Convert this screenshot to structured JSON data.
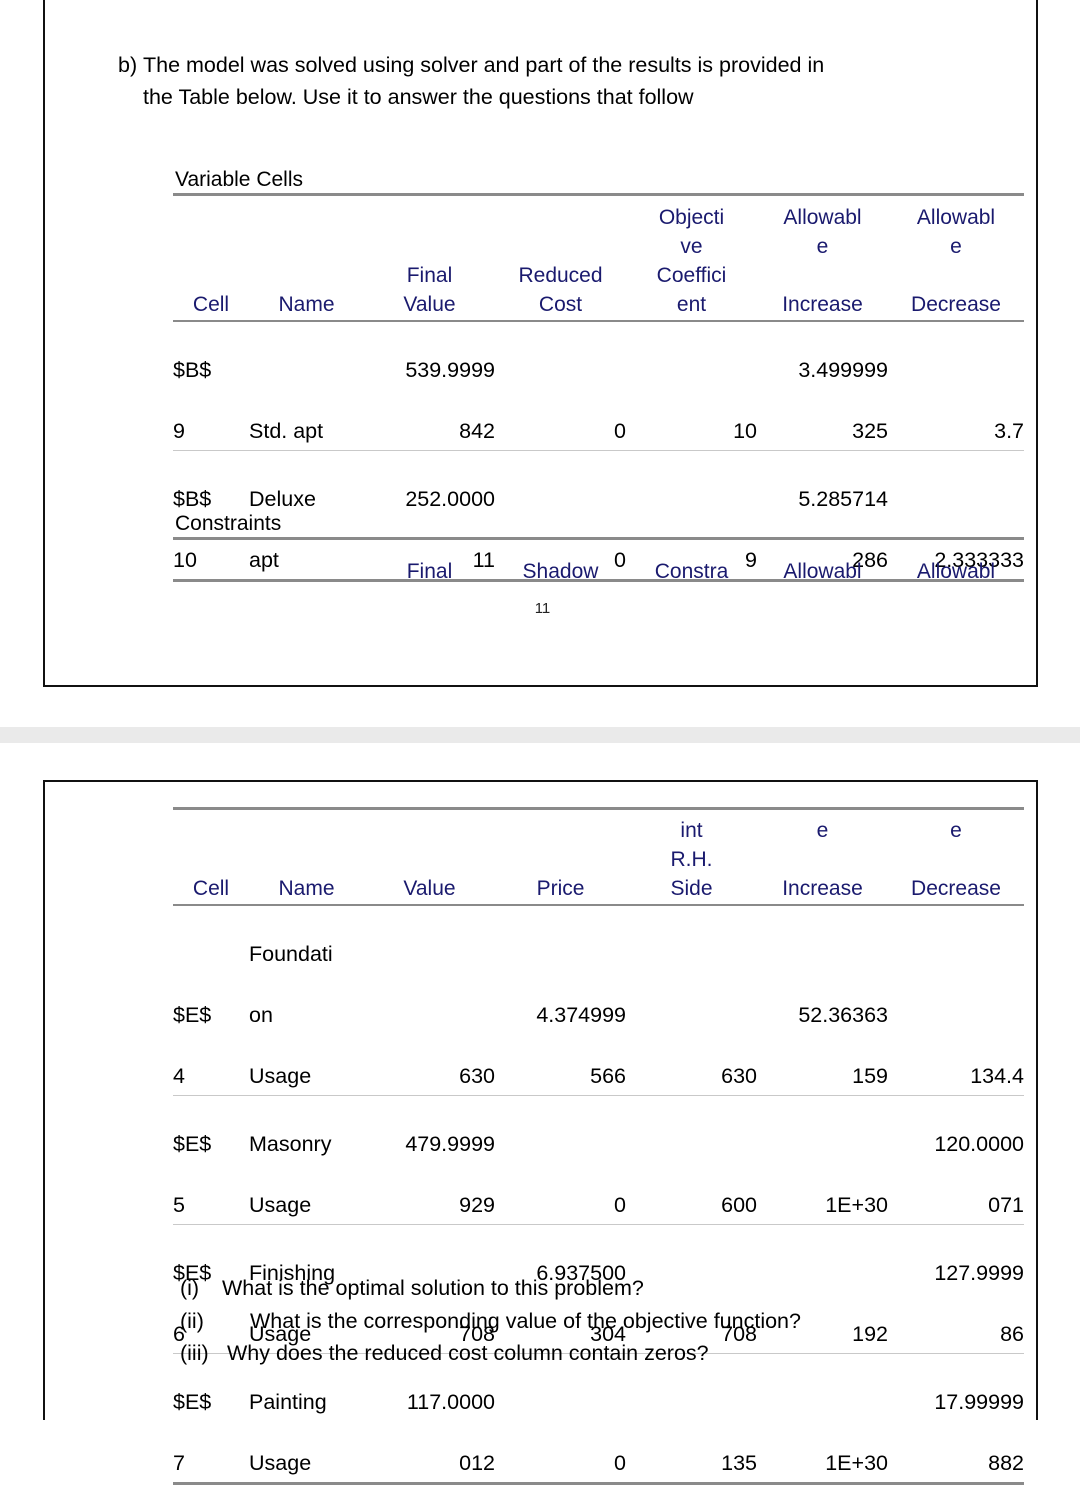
{
  "page1": {
    "intro": {
      "marker": "b)",
      "line1": "The model was solved using solver and part of the results is provided in",
      "line2": "the Table below. Use it to answer the questions that follow"
    },
    "variable_cells": {
      "caption": "Variable Cells",
      "headers": {
        "cell": "Cell",
        "name": "Name",
        "final_value": "Final\nValue",
        "reduced_cost": "Reduced\nCost",
        "objective_coefficient": "Objecti\nve\nCoeffici\nent",
        "allowable_increase": "Allowabl\ne\n\nIncrease",
        "allowable_decrease": "Allowabl\ne\n\nDecrease"
      },
      "rows": [
        {
          "cell_l1": "$B$",
          "cell_l2": "9",
          "name_l1": "",
          "name_l2": "Std. apt",
          "final_l1": "539.9999",
          "final_l2": "842",
          "reduced_l1": "",
          "reduced_l2": "0",
          "objective_l1": "",
          "objective_l2": "10",
          "increase_l1": "3.499999",
          "increase_l2": "325",
          "decrease_l1": "",
          "decrease_l2": "3.7"
        },
        {
          "cell_l1": "$B$",
          "cell_l2": "10",
          "name_l1": "Deluxe",
          "name_l2": "apt",
          "final_l1": "252.0000",
          "final_l2": "11",
          "reduced_l1": "",
          "reduced_l2": "0",
          "objective_l1": "",
          "objective_l2": "9",
          "increase_l1": "5.285714",
          "increase_l2": "286",
          "decrease_l1": "",
          "decrease_l2": "2.333333"
        }
      ]
    },
    "constraints": {
      "caption": "Constraints",
      "headers": {
        "cell": "",
        "name": "",
        "final": "Final",
        "shadow": "Shadow",
        "constraint": "Constra",
        "allowable_increase": "Allowabl",
        "allowable_decrease": "Allowabl"
      }
    },
    "page_number": "11"
  },
  "page2": {
    "constraints_cont": {
      "headers": {
        "cell": "Cell",
        "name": "Name",
        "final_value": "Value",
        "shadow_price": "Price",
        "constraint_rh_side": "int\nR.H.\nSide",
        "allowable_increase": "e\n\nIncrease",
        "allowable_decrease": "e\n\nDecrease"
      },
      "rows": [
        {
          "cell_l1": "$E$",
          "cell_l2": "4",
          "name_l1": "Foundati",
          "name_l2": "on",
          "name_l3": "Usage",
          "final_l1": "",
          "final_l2": "630",
          "shadow_l1": "4.374999",
          "shadow_l2": "566",
          "rhs_l1": "",
          "rhs_l2": "630",
          "increase_l1": "52.36363",
          "increase_l2": "159",
          "decrease_l1": "",
          "decrease_l2": "134.4"
        },
        {
          "cell_l1": "$E$",
          "cell_l2": "5",
          "name_l1": "Masonry",
          "name_l2": "Usage",
          "final_l1": "479.9999",
          "final_l2": "929",
          "shadow_l1": "",
          "shadow_l2": "0",
          "rhs_l1": "",
          "rhs_l2": "600",
          "increase_l1": "",
          "increase_l2": "1E+30",
          "decrease_l1": "120.0000",
          "decrease_l2": "071"
        },
        {
          "cell_l1": "$E$",
          "cell_l2": "6",
          "name_l1": "Finishing",
          "name_l2": "Usage",
          "final_l1": "",
          "final_l2": "708",
          "shadow_l1": "6.937500",
          "shadow_l2": "304",
          "rhs_l1": "",
          "rhs_l2": "708",
          "increase_l1": "",
          "increase_l2": "192",
          "decrease_l1": "127.9999",
          "decrease_l2": "86"
        },
        {
          "cell_l1": "$E$",
          "cell_l2": "7",
          "name_l1": "Painting",
          "name_l2": "Usage",
          "final_l1": "117.0000",
          "final_l2": "012",
          "shadow_l1": "",
          "shadow_l2": "0",
          "rhs_l1": "",
          "rhs_l2": "135",
          "increase_l1": "",
          "increase_l2": "1E+30",
          "decrease_l1": "17.99999",
          "decrease_l2": "882"
        }
      ]
    },
    "questions": [
      {
        "marker": "(i)",
        "text": "What is the optimal solution to this problem?"
      },
      {
        "marker": "(ii)",
        "text": "What is the corresponding value of the objective function?"
      },
      {
        "marker": "(iii)",
        "text": "Why does the reduced cost column contain zeros?"
      }
    ]
  },
  "colors": {
    "header_navy": "#1a1a6e",
    "rule_gray": "#8a8a8a",
    "row_sep_gray": "#c9c9c9",
    "page_border": "#111111",
    "page_gap": "#eaeaea"
  }
}
